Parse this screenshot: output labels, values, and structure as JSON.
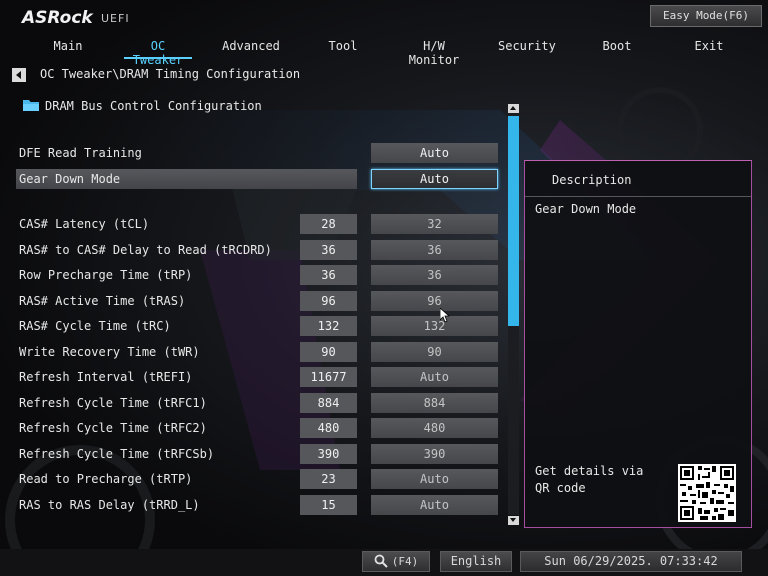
{
  "header": {
    "logo": "ASRock",
    "uefi": "UEFI",
    "easy_mode": "Easy Mode(F6)"
  },
  "tabs": [
    {
      "label": "Main",
      "active": false
    },
    {
      "label": "OC Tweaker",
      "active": true
    },
    {
      "label": "Advanced",
      "active": false
    },
    {
      "label": "Tool",
      "active": false
    },
    {
      "label": "H/W Monitor",
      "active": false
    },
    {
      "label": "Security",
      "active": false
    },
    {
      "label": "Boot",
      "active": false
    },
    {
      "label": "Exit",
      "active": false
    }
  ],
  "breadcrumb": "OC Tweaker\\DRAM Timing Configuration",
  "section_title": "DRAM Bus Control Configuration",
  "top_rows": [
    {
      "label": "DFE Read Training",
      "setting": "Auto"
    },
    {
      "label": "Gear Down Mode",
      "setting": "Auto"
    }
  ],
  "timing_rows": [
    {
      "label": "CAS# Latency (tCL)",
      "current": "28",
      "setting": "32"
    },
    {
      "label": "RAS# to CAS# Delay to Read  (tRCDRD)",
      "current": "36",
      "setting": "36"
    },
    {
      "label": "Row Precharge Time (tRP)",
      "current": "36",
      "setting": "36"
    },
    {
      "label": "RAS# Active Time (tRAS)",
      "current": "96",
      "setting": "96"
    },
    {
      "label": "RAS# Cycle Time (tRC)",
      "current": "132",
      "setting": "132"
    },
    {
      "label": "Write Recovery Time (tWR)",
      "current": "90",
      "setting": "90"
    },
    {
      "label": "Refresh Interval (tREFI)",
      "current": "11677",
      "setting": "Auto"
    },
    {
      "label": "Refresh Cycle Time (tRFC1)",
      "current": "884",
      "setting": "884"
    },
    {
      "label": "Refresh Cycle Time (tRFC2)",
      "current": "480",
      "setting": "480"
    },
    {
      "label": "Refresh Cycle Time (tRFCSb)",
      "current": "390",
      "setting": "390"
    },
    {
      "label": "Read to Precharge (tRTP)",
      "current": "23",
      "setting": "Auto"
    },
    {
      "label": "RAS to RAS Delay (tRRD_L)",
      "current": "15",
      "setting": "Auto"
    }
  ],
  "description": {
    "title": "Description",
    "text": "Gear Down Mode",
    "qr_text": "Get details via QR code"
  },
  "bottom": {
    "search": "(F4)",
    "language": "English",
    "datetime": "Sun 06/29/2025. 07:33:42"
  },
  "colors": {
    "accent": "#5ad0ff",
    "scroll_thumb": "#35b6ea",
    "panel_border": "#a84ea0"
  }
}
